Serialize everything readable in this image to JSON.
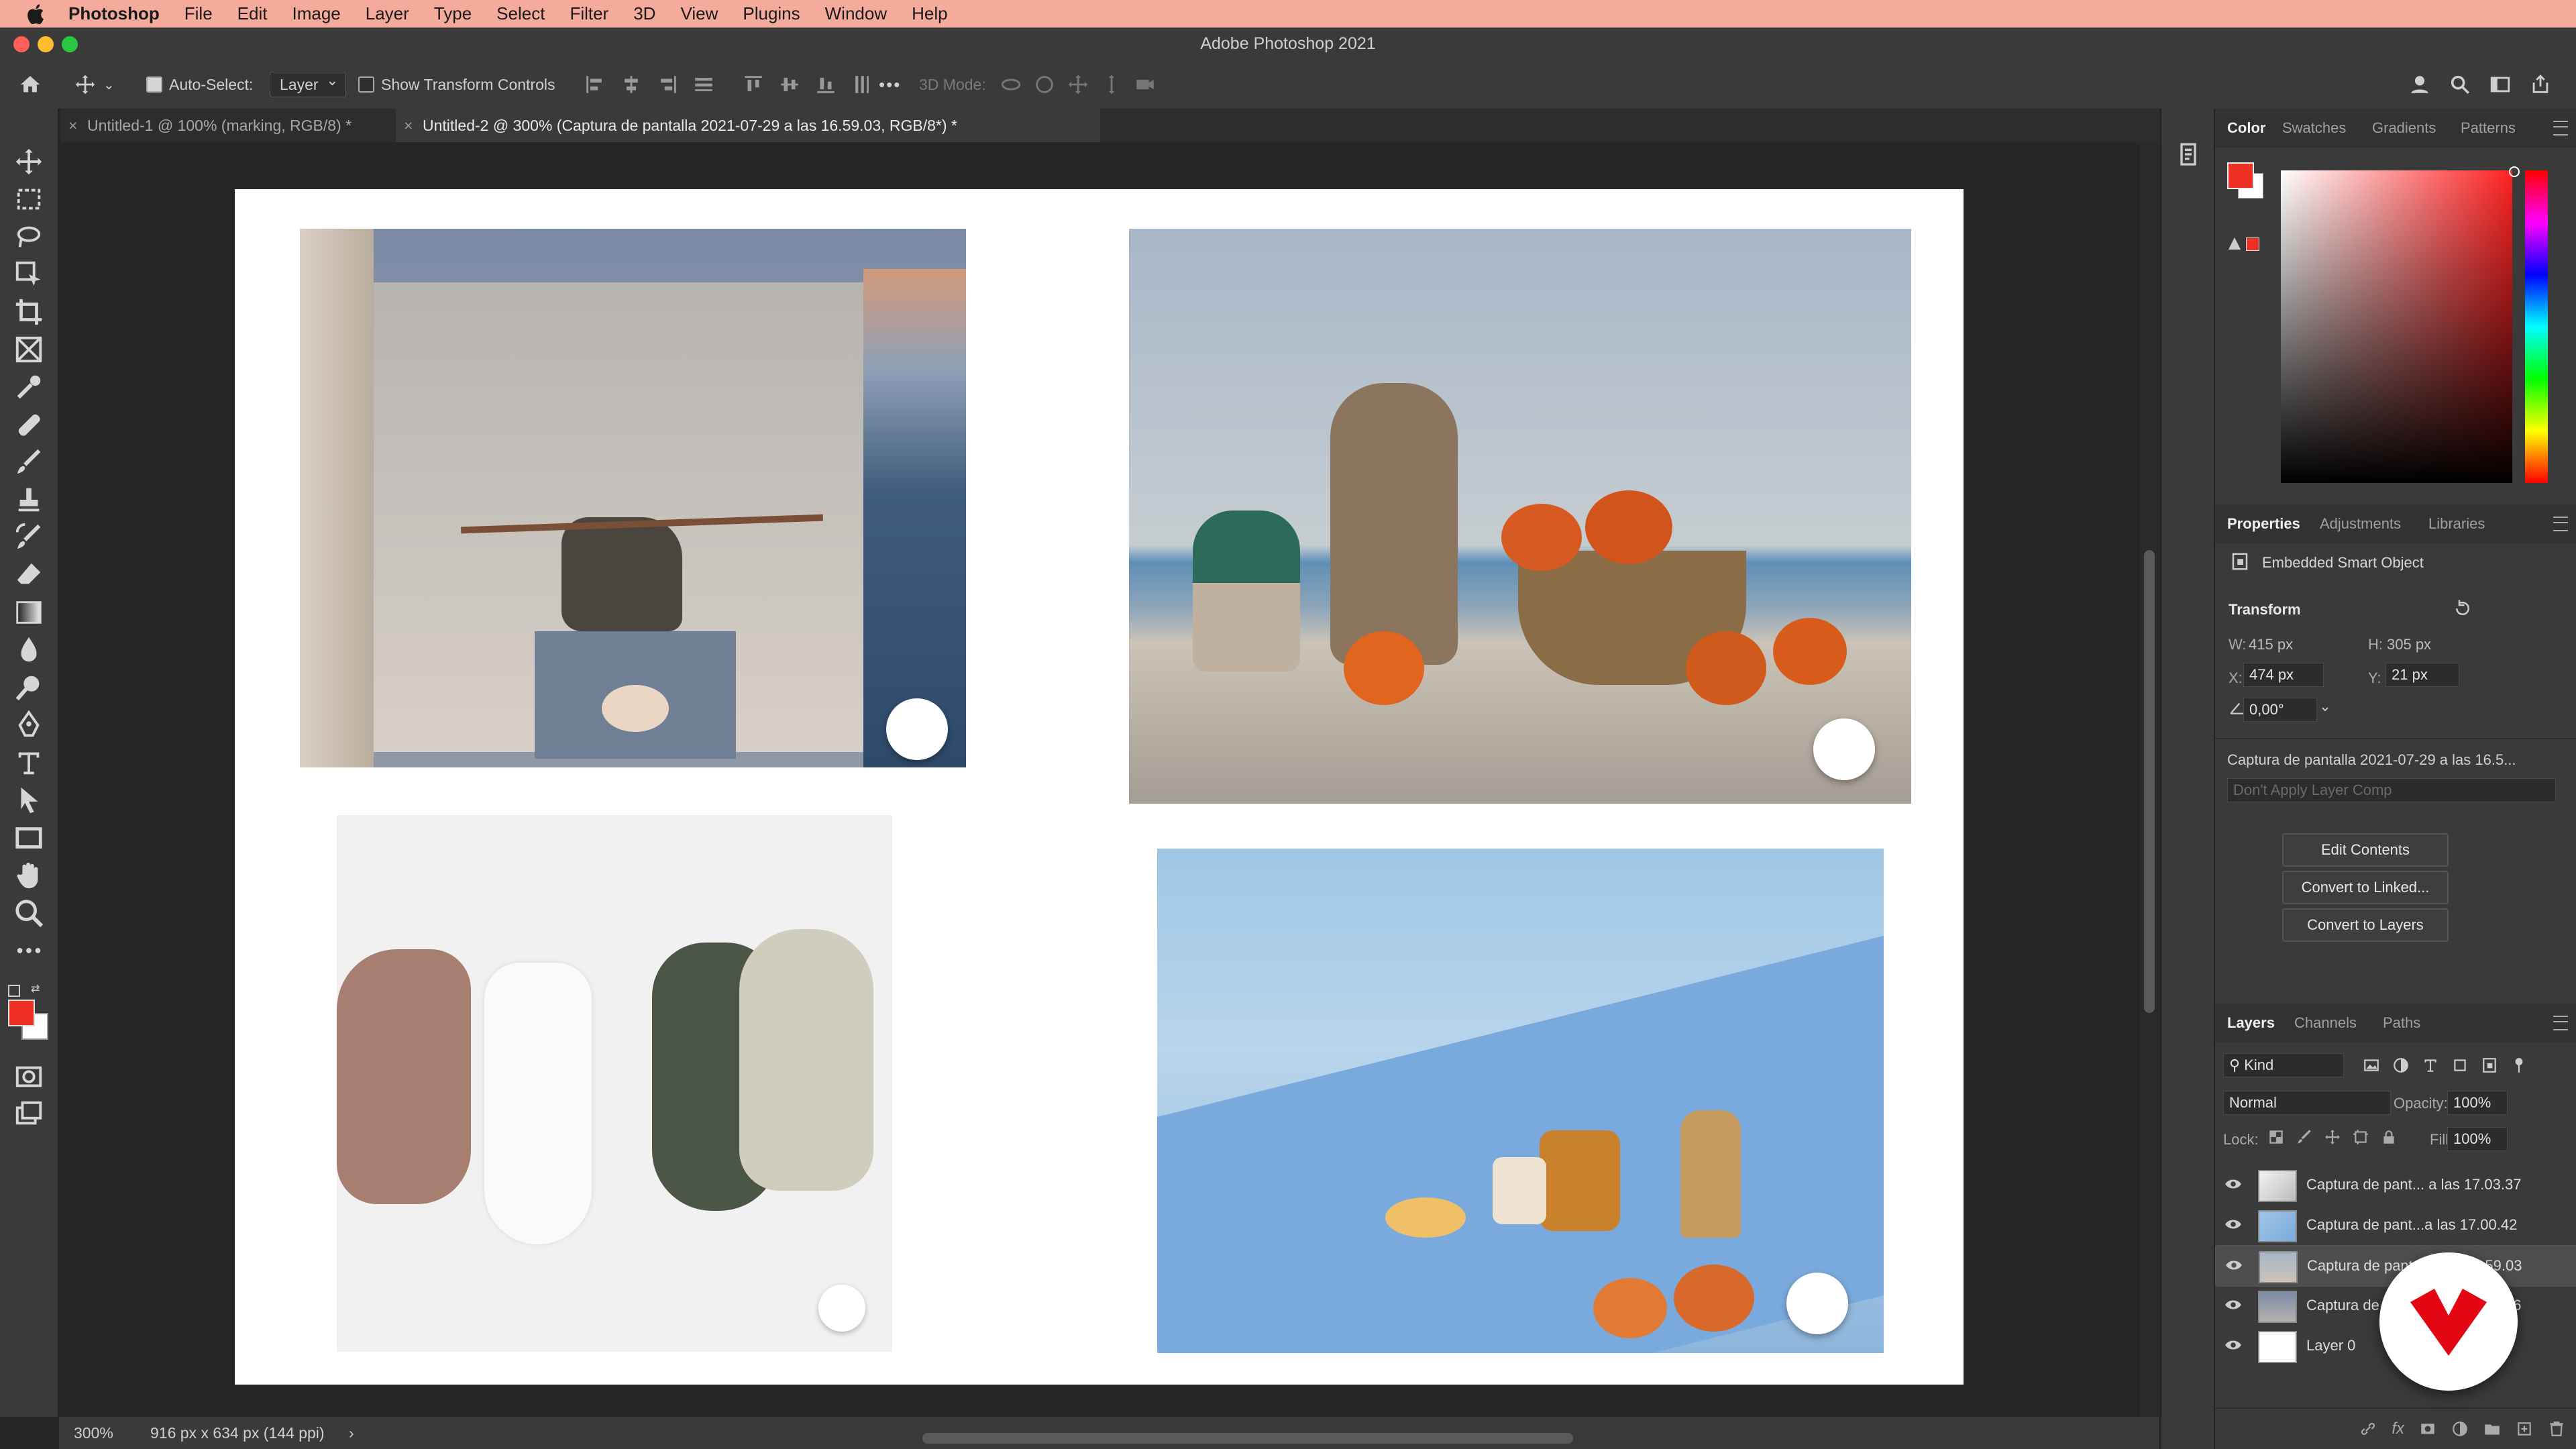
{
  "menubar": {
    "app_name": "Photoshop",
    "items": [
      "File",
      "Edit",
      "Image",
      "Layer",
      "Type",
      "Select",
      "Filter",
      "3D",
      "View",
      "Plugins",
      "Window",
      "Help"
    ]
  },
  "window": {
    "title": "Adobe Photoshop 2021"
  },
  "options_bar": {
    "auto_select_label": "Auto-Select:",
    "auto_select_checked": true,
    "auto_select_target": "Layer",
    "show_transform_label": "Show Transform Controls",
    "show_transform_checked": false,
    "more_glyph": "•••",
    "three_d_mode_label": "3D Mode:"
  },
  "tabs": [
    {
      "label": "Untitled-1 @ 100% (marking, RGB/8) *",
      "close": "×",
      "active": false
    },
    {
      "label": "Untitled-2 @ 300% (Captura de pantalla 2021-07-29 a las 16.59.03, RGB/8*) *",
      "close": "×",
      "active": true
    }
  ],
  "status": {
    "zoom": "300%",
    "doc_size": "916 px x 634 px (144 ppi)",
    "arrow": "›"
  },
  "color_panel": {
    "tabs": [
      "Color",
      "Swatches",
      "Gradients",
      "Patterns"
    ],
    "active_tab": "Color",
    "foreground": "#ee3124",
    "background": "#ffffff"
  },
  "properties_panel": {
    "tabs": [
      "Properties",
      "Adjustments",
      "Libraries"
    ],
    "active_tab": "Properties",
    "object_type": "Embedded Smart Object",
    "section": "Transform",
    "w_label": "W:",
    "w_value": "415 px",
    "h_label": "H:",
    "h_value": "305 px",
    "x_label": "X:",
    "x_value": "474 px",
    "y_label": "Y:",
    "y_value": "21 px",
    "angle_value": "0,00°",
    "source_name": "Captura de pantalla 2021-07-29 a las 16.5...",
    "layer_comp": "Don't Apply Layer Comp",
    "buttons": [
      "Edit Contents",
      "Convert to Linked...",
      "Convert to Layers"
    ]
  },
  "layers_panel": {
    "tabs": [
      "Layers",
      "Channels",
      "Paths"
    ],
    "active_tab": "Layers",
    "filter_kind": "Kind",
    "blend_mode": "Normal",
    "opacity_label": "Opacity:",
    "opacity_value": "100%",
    "lock_label": "Lock:",
    "fill_label": "Fill:",
    "fill_value": "100%",
    "layers": [
      {
        "name": "Captura de pant... a las 17.03.37",
        "selected": false
      },
      {
        "name": "Captura de pant...a las 17.00.42",
        "selected": false
      },
      {
        "name": "Captura de pant... a las 16.59.03",
        "selected": true
      },
      {
        "name": "Captura de pant... a las 16.58.36",
        "selected": false
      },
      {
        "name": "Layer 0",
        "selected": false
      }
    ]
  },
  "colors": {
    "menubar_bg": "#f4ab9c",
    "ui_bg": "#3a3a3a",
    "canvas_bg": "#262626",
    "accent_red": "#ee3124",
    "logo_red": "#e30613"
  }
}
